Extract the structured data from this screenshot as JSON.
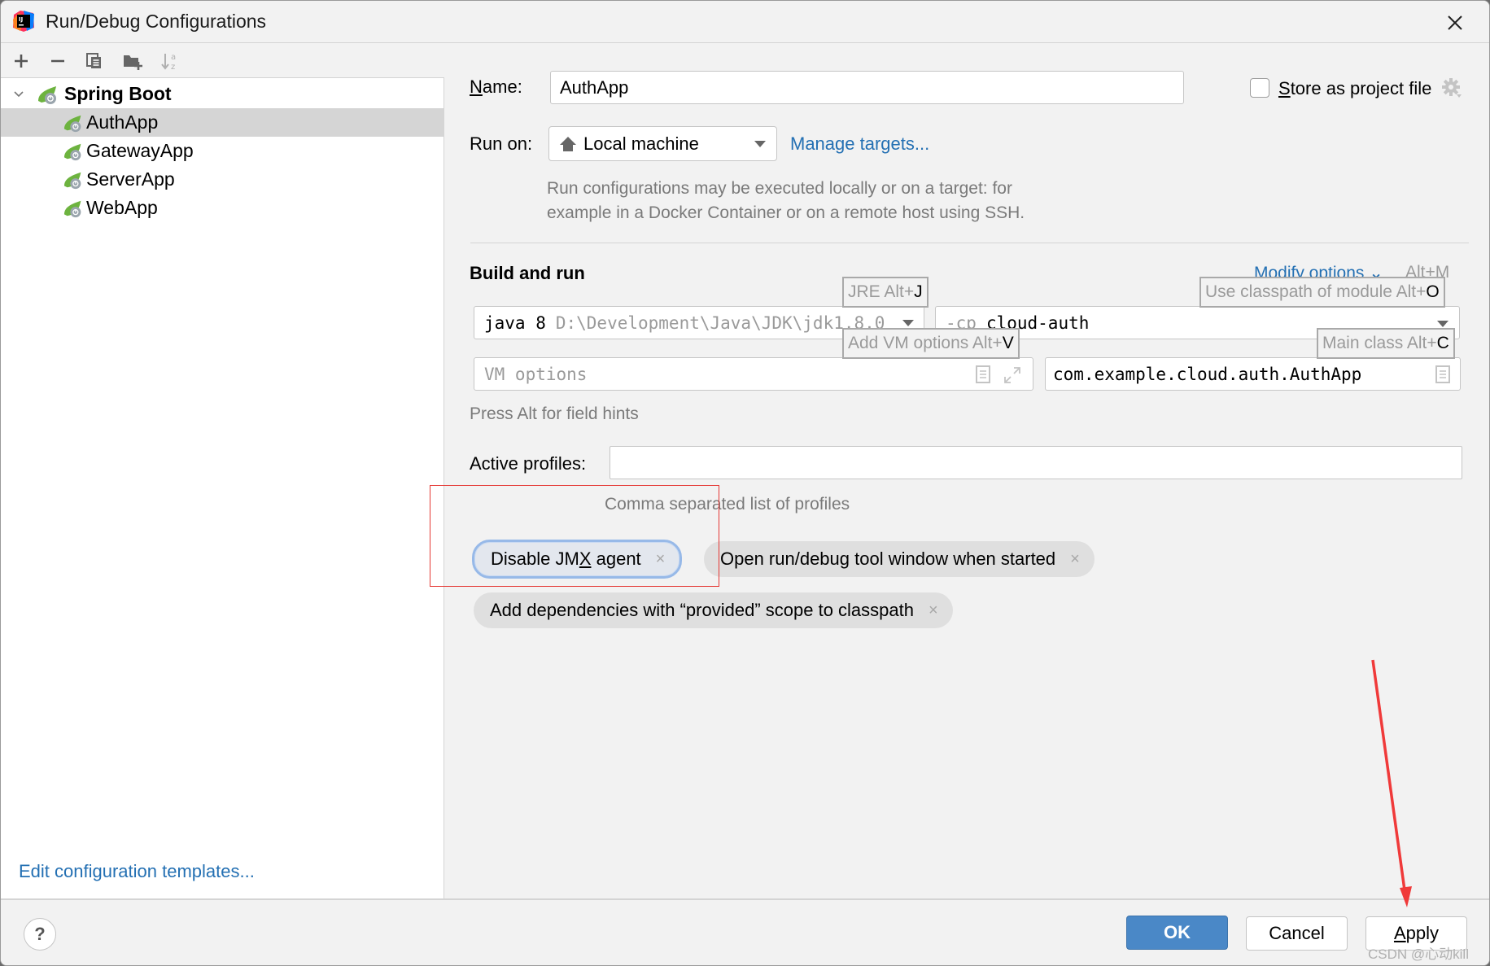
{
  "window": {
    "title": "Run/Debug Configurations",
    "app_icon": "intellij-idea-icon",
    "close_icon": "close-icon"
  },
  "toolbar": {
    "buttons": [
      {
        "name": "add-configuration",
        "icon": "plus-icon"
      },
      {
        "name": "remove-configuration",
        "icon": "minus-icon"
      },
      {
        "name": "copy-configuration",
        "icon": "copy-icon"
      },
      {
        "name": "move-into-folder",
        "icon": "new-folder-icon"
      },
      {
        "name": "sort-configurations",
        "icon": "sort-alpha-icon"
      }
    ]
  },
  "tree": {
    "group": {
      "label": "Spring Boot",
      "expanded": true,
      "icon": "spring-boot-icon"
    },
    "items": [
      {
        "label": "AuthApp",
        "selected": true,
        "icon": "spring-boot-icon"
      },
      {
        "label": "GatewayApp",
        "selected": false,
        "icon": "spring-boot-icon"
      },
      {
        "label": "ServerApp",
        "selected": false,
        "icon": "spring-boot-icon"
      },
      {
        "label": "WebApp",
        "selected": false,
        "icon": "spring-boot-icon"
      }
    ],
    "edit_templates_link": "Edit configuration templates..."
  },
  "form": {
    "name_label_mnemonic": "N",
    "name_label_rest": "ame:",
    "name_value": "AuthApp",
    "store_as_project_file": {
      "mnemonic": "S",
      "rest": "tore as project file",
      "checked": false
    },
    "run_on_label": "Run on:",
    "run_on_value": "Local machine",
    "manage_targets_link": "Manage targets...",
    "run_on_description_line1": "Run configurations may be executed locally or on a target: for",
    "run_on_description_line2": "example in a Docker Container or on a remote host using SSH.",
    "build_and_run_heading": "Build and run",
    "modify_options_link": "Modify options",
    "modify_options_shortcut": "Alt+M",
    "jre_prefix": "java 8",
    "jre_path": "D:\\Development\\Java\\JDK\\jdk1.8.0",
    "classpath_prefix": "-cp",
    "classpath_module": "cloud-auth",
    "vm_options_placeholder": "VM options",
    "vm_options_value": "",
    "main_class_value": "com.example.cloud.auth.AuthApp",
    "field_hints_text": "Press Alt for field hints",
    "active_profiles_label": "Active profiles:",
    "active_profiles_value": "",
    "active_profiles_hint": "Comma separated list of profiles"
  },
  "shortcut_hints": {
    "jre": {
      "text": "JRE Alt+",
      "key": "J"
    },
    "classpath": {
      "text": "Use classpath of module Alt+",
      "key": "O"
    },
    "vm_options": {
      "text": "Add VM options Alt+",
      "key": "V"
    },
    "main_class": {
      "text": "Main class Alt+",
      "key": "C"
    }
  },
  "options_chips": [
    {
      "pre": "Disable JM",
      "mnemonic": "X",
      "post": " agent",
      "focused": true
    },
    {
      "pre": "Open run/debug tool window when started",
      "mnemonic": "",
      "post": "",
      "focused": false
    },
    {
      "pre": "Add dependencies with “provided” scope to classpath",
      "mnemonic": "",
      "post": "",
      "focused": false
    }
  ],
  "chip_remove_glyph": "×",
  "buttons": {
    "ok": "OK",
    "cancel": "Cancel",
    "apply_mnemonic": "A",
    "apply_rest": "pply",
    "help": "?"
  },
  "annotations": {
    "highlight_color": "#e53935",
    "arrow_color": "#f03a3a"
  },
  "watermark": "CSDN @心动kill"
}
